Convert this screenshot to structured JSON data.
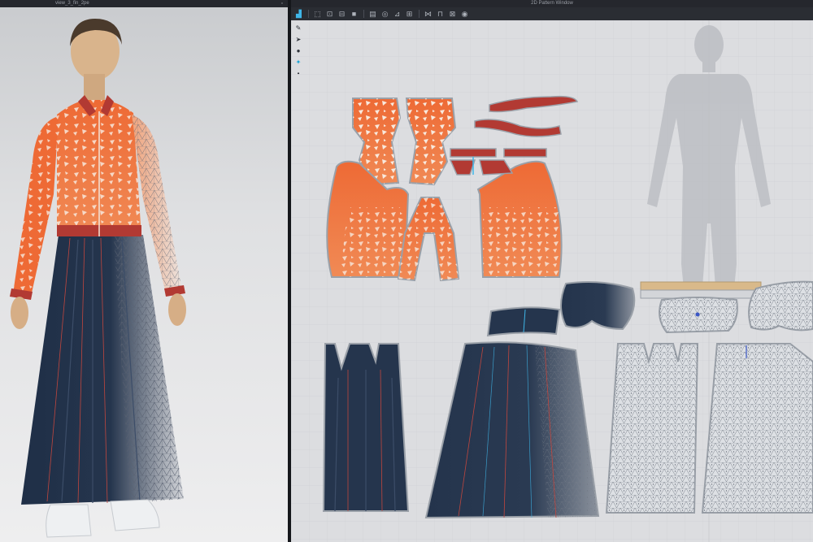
{
  "window": {
    "view3d_title": "view_3_fin_2pe",
    "view2d_title": "2D Pattern Window"
  },
  "toolbar_2d": {
    "tools": [
      {
        "name": "select-tool-icon",
        "glyph": "▟",
        "active": true
      },
      {
        "name": "transform-tool-icon",
        "glyph": "⬚",
        "active": false
      },
      {
        "name": "edit-point-icon",
        "glyph": "⊡",
        "active": false
      },
      {
        "name": "segment-tool-icon",
        "glyph": "⊟",
        "active": false
      },
      {
        "name": "polygon-tool-icon",
        "glyph": "■",
        "active": false
      },
      {
        "name": "rectangle-tool-icon",
        "glyph": "▤",
        "active": false
      },
      {
        "name": "circle-tool-icon",
        "glyph": "◎",
        "active": false
      },
      {
        "name": "internal-line-icon",
        "glyph": "⊿",
        "active": false
      },
      {
        "name": "dart-tool-icon",
        "glyph": "⊞",
        "active": false
      },
      {
        "name": "seam-tool-icon",
        "glyph": "⋈",
        "active": false
      },
      {
        "name": "fold-tool-icon",
        "glyph": "⊓",
        "active": false
      },
      {
        "name": "pleat-tool-icon",
        "glyph": "⊠",
        "active": false
      },
      {
        "name": "button-tool-icon",
        "glyph": "◉",
        "active": false
      }
    ]
  },
  "side_tools_2d": [
    {
      "name": "brush-icon",
      "glyph": "✎",
      "active": false
    },
    {
      "name": "arrow-icon",
      "glyph": "➤",
      "active": false
    },
    {
      "name": "chat-icon",
      "glyph": "●",
      "active": false
    },
    {
      "name": "pin-icon",
      "glyph": "✦",
      "active": true
    },
    {
      "name": "small-dot-icon",
      "glyph": "•",
      "active": false
    }
  ],
  "colors": {
    "orange": "#ee6a35",
    "orange_light": "#f59a64",
    "red_trim": "#b23a33",
    "navy": "#25354d",
    "pattern_outline": "#9aa0a8",
    "grid_bg": "#dcdde0",
    "accent": "#3fb6e8"
  }
}
